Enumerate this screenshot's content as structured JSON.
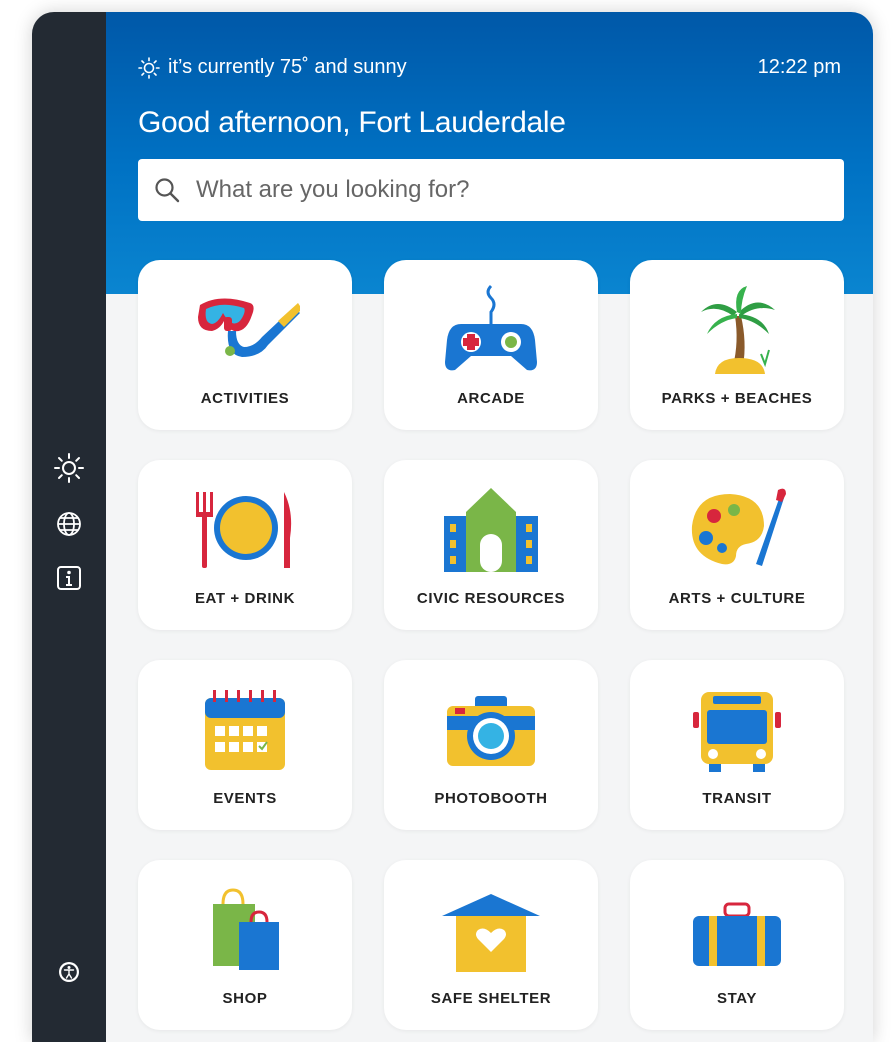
{
  "header": {
    "weather_text": "it’s currently 75˚ and sunny",
    "time": "12:22 pm",
    "greeting": "Good afternoon, Fort Lauderdale"
  },
  "search": {
    "placeholder": "What are you looking for?"
  },
  "sidebar": {
    "items": [
      {
        "icon": "brightness-icon"
      },
      {
        "icon": "globe-icon"
      },
      {
        "icon": "info-icon"
      },
      {
        "icon": "accessibility-icon"
      }
    ]
  },
  "tiles": [
    {
      "label": "ACTIVITIES",
      "icon": "snorkel-mask-icon"
    },
    {
      "label": "ARCADE",
      "icon": "game-controller-icon"
    },
    {
      "label": "PARKS + BEACHES",
      "icon": "palm-tree-icon"
    },
    {
      "label": "EAT + DRINK",
      "icon": "plate-utensils-icon"
    },
    {
      "label": "CIVIC RESOURCES",
      "icon": "civic-building-icon"
    },
    {
      "label": "ARTS + CULTURE",
      "icon": "paint-palette-icon"
    },
    {
      "label": "EVENTS",
      "icon": "calendar-icon"
    },
    {
      "label": "PHOTOBOOTH",
      "icon": "camera-icon"
    },
    {
      "label": "TRANSIT",
      "icon": "bus-icon"
    },
    {
      "label": "SHOP",
      "icon": "shopping-bags-icon"
    },
    {
      "label": "SAFE SHELTER",
      "icon": "shelter-heart-icon"
    },
    {
      "label": "STAY",
      "icon": "suitcase-icon"
    }
  ],
  "colors": {
    "header_blue": "#0067b8",
    "sidebar": "#232a33",
    "accent_yellow": "#f2c12e",
    "accent_red": "#d7263d",
    "accent_green": "#7ab648"
  }
}
